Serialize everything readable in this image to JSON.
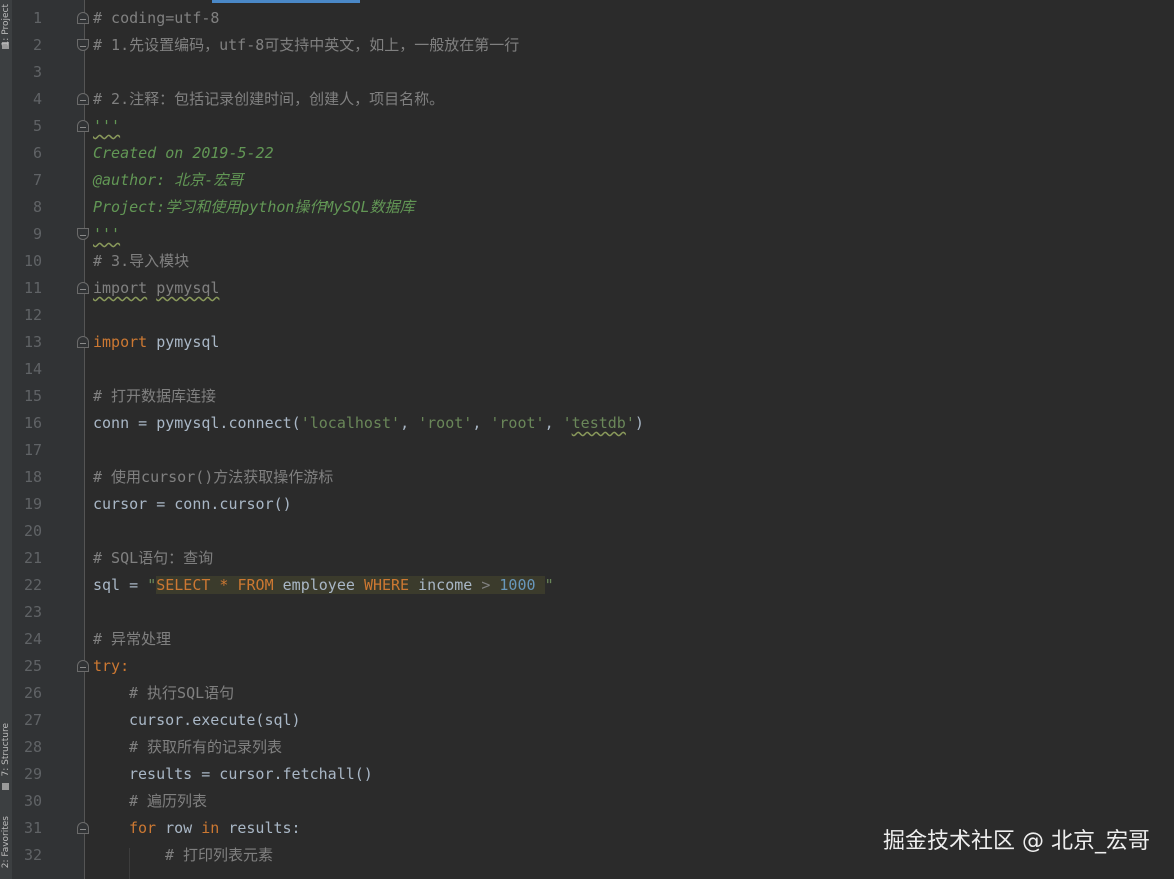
{
  "tool_windows": {
    "project": "1: Project",
    "structure": "7: Structure",
    "favorites": "2: Favorites"
  },
  "line_numbers": [
    "1",
    "2",
    "3",
    "4",
    "5",
    "6",
    "7",
    "8",
    "9",
    "10",
    "11",
    "12",
    "13",
    "14",
    "15",
    "16",
    "17",
    "18",
    "19",
    "20",
    "21",
    "22",
    "23",
    "24",
    "25",
    "26",
    "27",
    "28",
    "29",
    "30",
    "31",
    "32"
  ],
  "code": {
    "l1": "# coding=utf-8",
    "l2": "# 1.先设置编码，utf-8可支持中英文，如上，一般放在第一行",
    "l4": "# 2.注释：包括记录创建时间，创建人，项目名称。",
    "l5_quotes": "'''",
    "l6": "Created on 2019-5-22",
    "l7": "@author: 北京-宏哥",
    "l8": "Project:学习和使用python操作MySQL数据库",
    "l9_quotes": "'''",
    "l10": "# 3.导入模块",
    "l11_kw": "import",
    "l11_mod": "pymysql",
    "l13_kw": "import",
    "l13_mod": "pymysql",
    "l15": "# 打开数据库连接",
    "l16_a": "conn = pymysql.connect(",
    "l16_s1": "'localhost'",
    "l16_s2": "'root'",
    "l16_s3": "'root'",
    "l16_s4a": "'",
    "l16_s4b": "testdb",
    "l16_s4c": "'",
    "l16_end": ")",
    "l18": "# 使用cursor()方法获取操作游标",
    "l19": "cursor = conn.cursor()",
    "l21": "# SQL语句：查询",
    "l22_a": "sql = ",
    "l22_q1": "\"",
    "l22_select": "SELECT",
    "l22_star": " * ",
    "l22_from": "FROM",
    "l22_table": " employee ",
    "l22_where": "WHERE",
    "l22_col": " income ",
    "l22_gt": "> ",
    "l22_num": "1000",
    "l22_q2": "\"",
    "l24": "# 异常处理",
    "l25_kw": "try",
    "l25_colon": ":",
    "l26": "# 执行SQL语句",
    "l27": "cursor.execute(sql)",
    "l28": "# 获取所有的记录列表",
    "l29": "results = cursor.fetchall()",
    "l30": "# 遍历列表",
    "l31_for": "for",
    "l31_row": " row ",
    "l31_in": "in",
    "l31_rest": " results:",
    "l32": "# 打印列表元素"
  },
  "watermark": "掘金技术社区 @ 北京_宏哥",
  "colors": {
    "background": "#2b2b2b",
    "gutter": "#313335",
    "comment": "#808080",
    "docstring": "#629755",
    "keyword": "#cc7832",
    "string": "#6a8759",
    "number": "#6897bb",
    "text": "#a9b7c6"
  }
}
